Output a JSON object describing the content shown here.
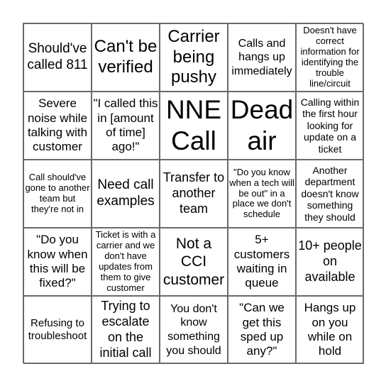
{
  "board": {
    "rows": [
      [
        {
          "text": "Should've called 811",
          "size": "s19"
        },
        {
          "text": "Can't be verified",
          "size": "s24"
        },
        {
          "text": "Carrier being pushy",
          "size": "s24"
        },
        {
          "text": "Calls and hangs up immediately",
          "size": "s16"
        },
        {
          "text": "Doesn't have correct information for identifying the trouble line/circuit",
          "size": "s13"
        }
      ],
      [
        {
          "text": "Severe noise while talking with customer",
          "size": "s17"
        },
        {
          "text": "\"I called this in [amount of time] ago!\"",
          "size": "s17"
        },
        {
          "text": "NNE Call",
          "size": "s36"
        },
        {
          "text": "Dead air",
          "size": "s36"
        },
        {
          "text": "Calling within the first hour looking for update on a ticket",
          "size": "s14"
        }
      ],
      [
        {
          "text": "Call should've gone to another team but they're not in",
          "size": "s13"
        },
        {
          "text": "Need call examples",
          "size": "s19"
        },
        {
          "text": "Transfer to another team",
          "size": "s18"
        },
        {
          "text": "\"Do you know when a tech will be out\" in a place we don't schedule",
          "size": "s13"
        },
        {
          "text": "Another department doesn't know something they should",
          "size": "s14"
        }
      ],
      [
        {
          "text": "\"Do you know when this will be fixed?\"",
          "size": "s17"
        },
        {
          "text": "Ticket is with a carrier and we don't have updates from them to give customer",
          "size": "s13"
        },
        {
          "text": "Not a CCI customer",
          "size": "s21"
        },
        {
          "text": "5+ customers waiting in queue",
          "size": "s17"
        },
        {
          "text": "10+ people on available",
          "size": "s18"
        }
      ],
      [
        {
          "text": "Refusing to troubleshoot",
          "size": "s15"
        },
        {
          "text": "Trying to escalate on the initial call",
          "size": "s18"
        },
        {
          "text": "You don't know something you should",
          "size": "s16"
        },
        {
          "text": "\"Can we get this sped up any?\"",
          "size": "s17"
        },
        {
          "text": "Hangs up on you while on hold",
          "size": "s17"
        }
      ]
    ]
  }
}
